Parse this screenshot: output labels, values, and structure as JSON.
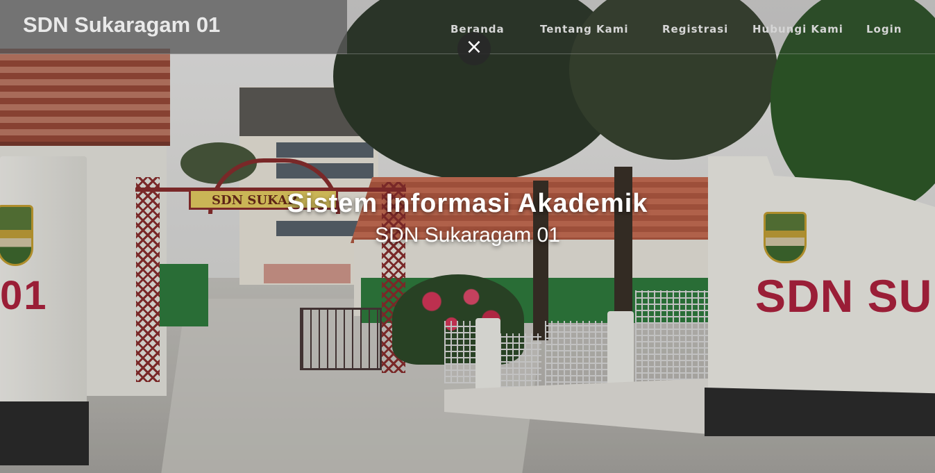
{
  "navbar": {
    "brand": "SDN Sukaragam 01",
    "items": [
      {
        "label": "Beranda"
      },
      {
        "label": "Tentang Kami"
      },
      {
        "label": "Registrasi"
      },
      {
        "label": "Hubungi Kami"
      },
      {
        "label": "Login"
      }
    ],
    "close_icon": "×"
  },
  "hero": {
    "title": "Sistem Informasi Akademik",
    "subtitle": "SDN Sukaragam 01",
    "photo": {
      "gate_sign_text": "SDN SUKAR",
      "left_wall_text": "01",
      "right_wall_text": "SDN SUKA"
    }
  },
  "colors": {
    "accent_text": "#ffffff",
    "wall_lettering": "#b0233f"
  }
}
